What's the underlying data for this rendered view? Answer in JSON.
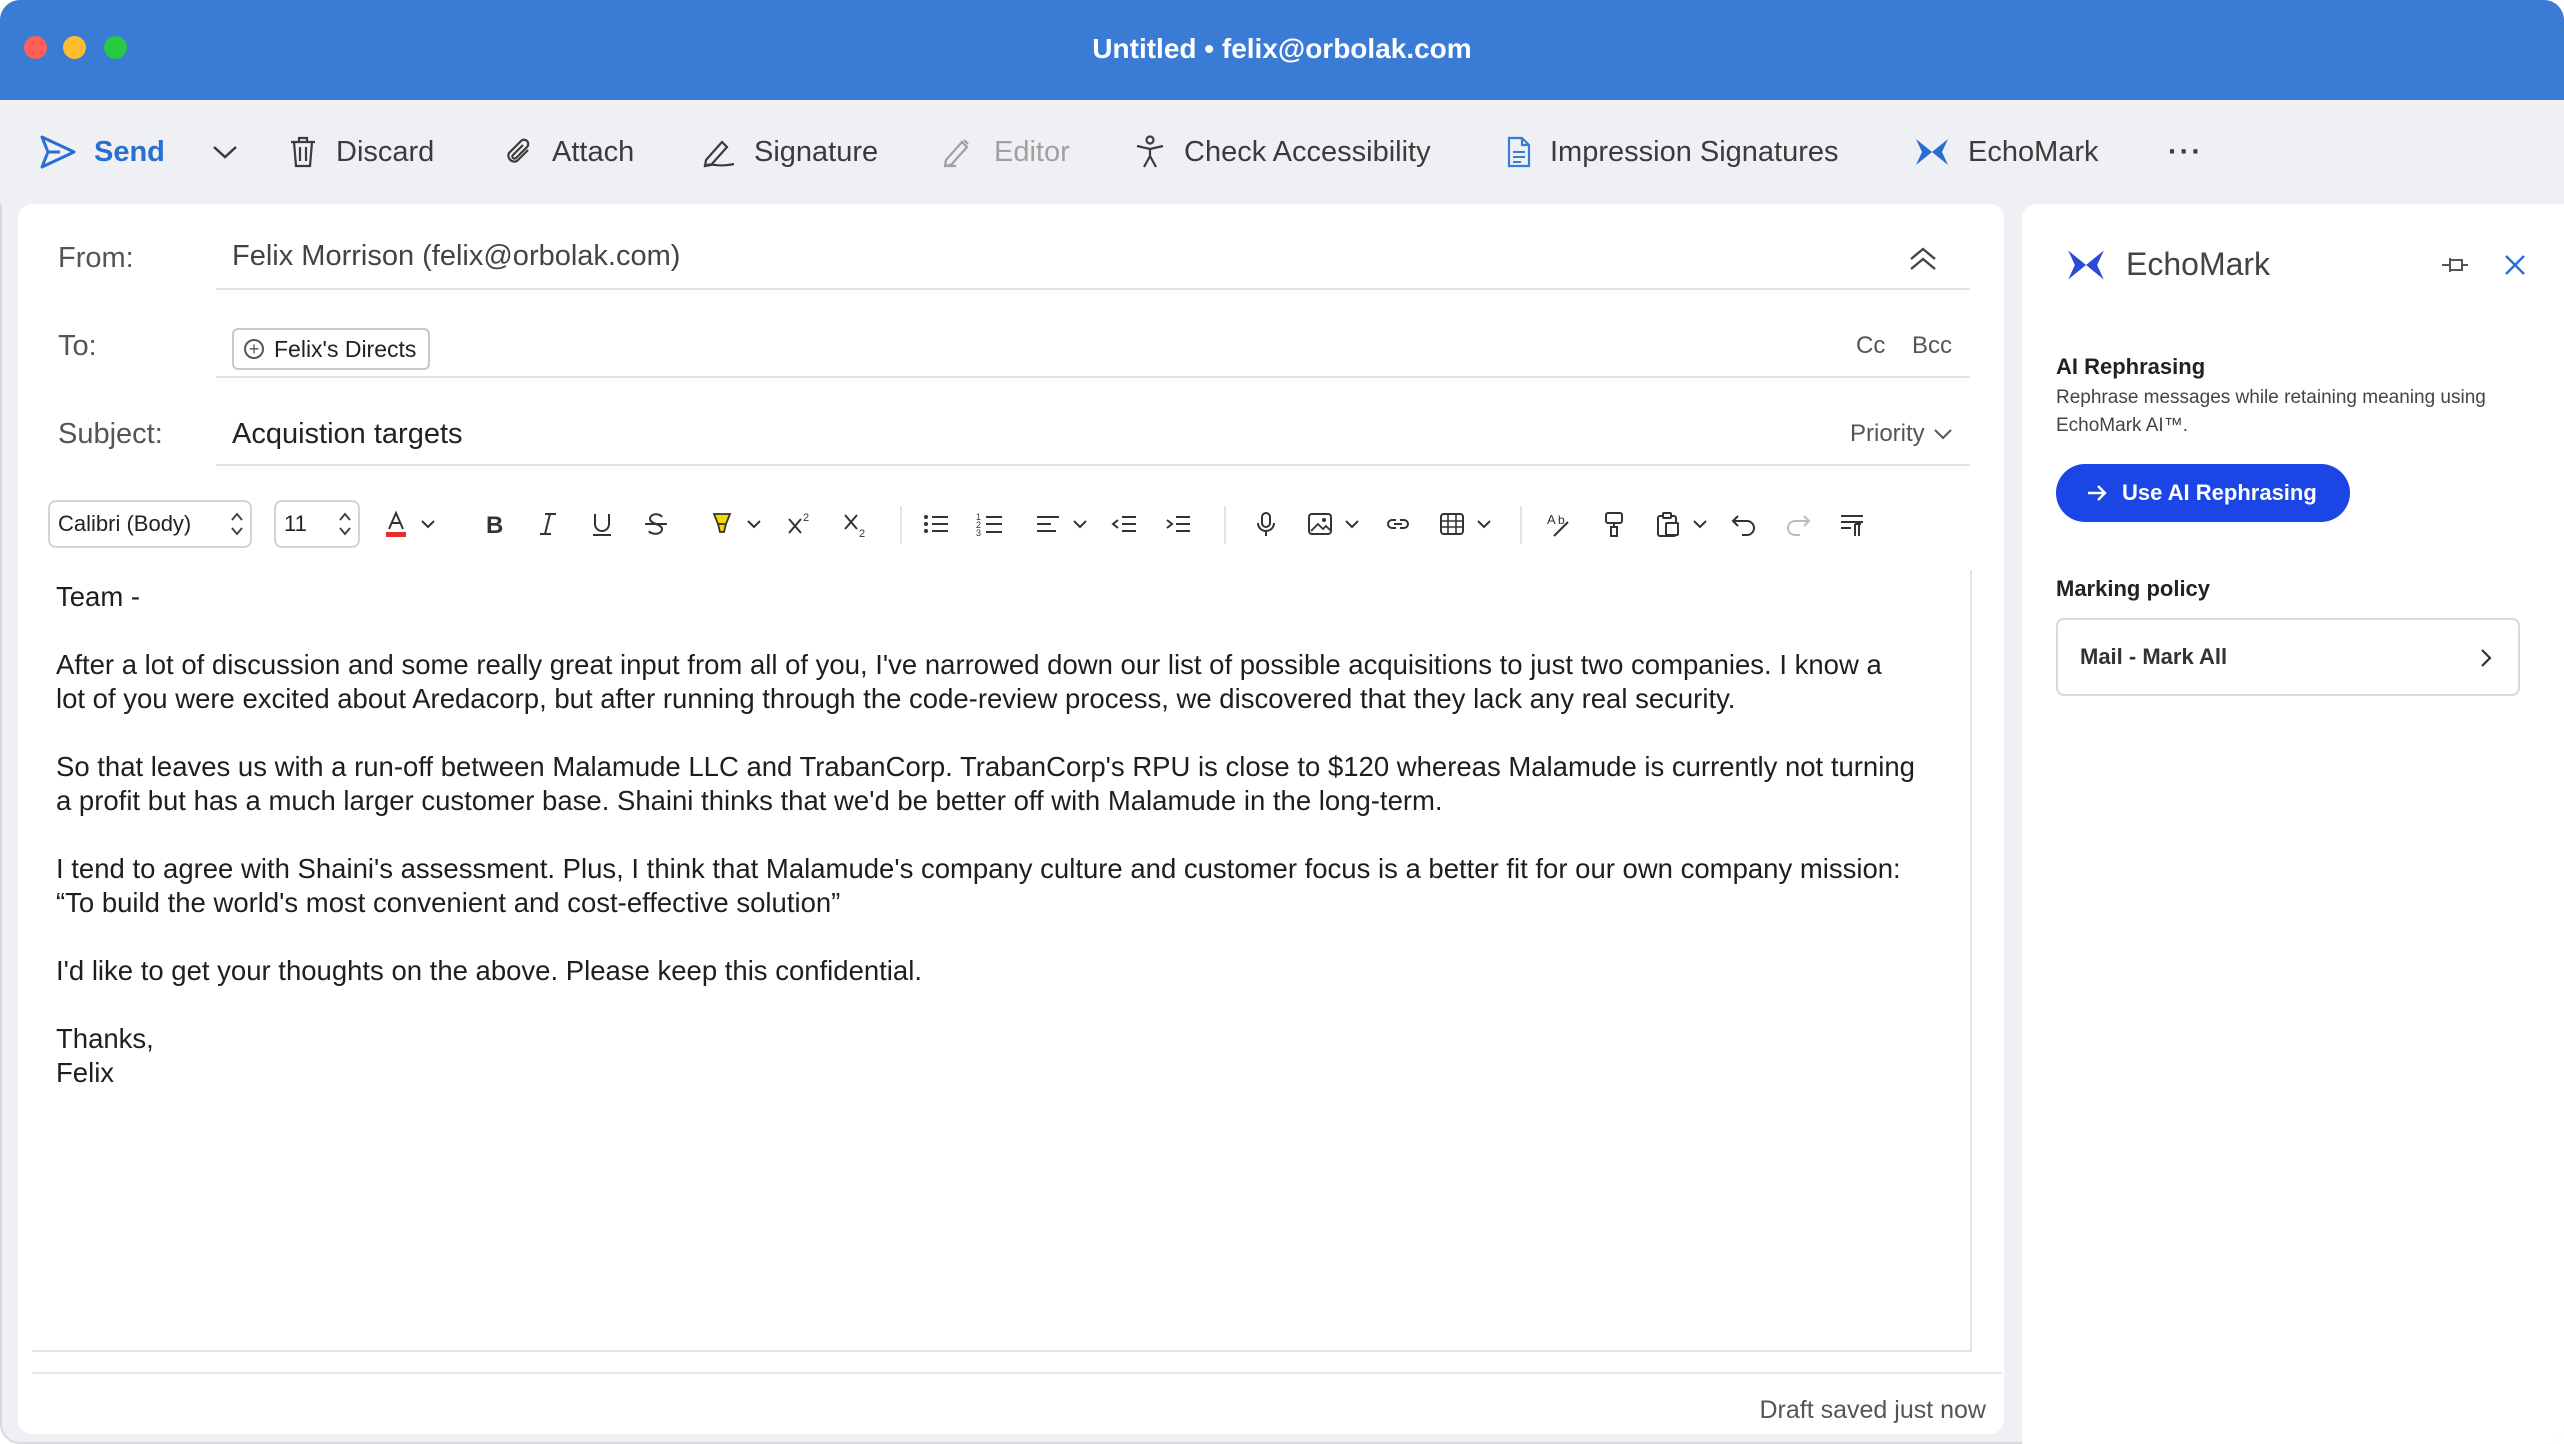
{
  "window": {
    "title": "Untitled • felix@orbolak.com"
  },
  "toolbar": {
    "send": "Send",
    "discard": "Discard",
    "attach": "Attach",
    "signature": "Signature",
    "editor": "Editor",
    "check_accessibility": "Check Accessibility",
    "impression_signatures": "Impression Signatures",
    "echomark": "EchoMark",
    "more": "···"
  },
  "compose": {
    "from_label": "From:",
    "from_value": "Felix Morrison (felix@orbolak.com)",
    "to_label": "To:",
    "to_recipient": "Felix's Directs",
    "cc": "Cc",
    "bcc": "Bcc",
    "subject_label": "Subject:",
    "subject_value": "Acquistion targets",
    "priority": "Priority"
  },
  "format": {
    "font": "Calibri (Body)",
    "size": "11"
  },
  "body": {
    "greeting": "Team -",
    "p1": "After a lot of discussion and some really great input from all of you, I've narrowed down our list of possible acquisitions to just two companies. I know a lot of you were excited about Aredacorp, but after running through the code-review process, we discovered that they lack any real security.",
    "p2": "So that leaves us with a run-off between Malamude LLC and TrabanCorp. TrabanCorp's RPU is close to $120 whereas Malamude is currently not turning a profit but has a much larger customer base. Shaini thinks that we'd be better off with Malamude in the long-term.",
    "p3": "I tend to agree with Shaini's assessment. Plus, I think that Malamude's company culture and customer focus is a better fit for our own company mission: “To build the world's most convenient and cost-effective solution”",
    "p4": "I'd like to get your thoughts on the above. Please keep this confidential.",
    "closing": "Thanks,",
    "name": "Felix"
  },
  "status": {
    "draft": "Draft saved just now"
  },
  "pane": {
    "title": "EchoMark",
    "ai_heading": "AI Rephrasing",
    "ai_desc": "Rephrase messages while retaining meaning using EchoMark AI™.",
    "ai_button": "Use AI Rephrasing",
    "policy_heading": "Marking policy",
    "policy_value": "Mail - Mark All"
  },
  "colors": {
    "titlebar": "#3a7bd5",
    "accent": "#2a6ed1",
    "button": "#1c45e6"
  }
}
